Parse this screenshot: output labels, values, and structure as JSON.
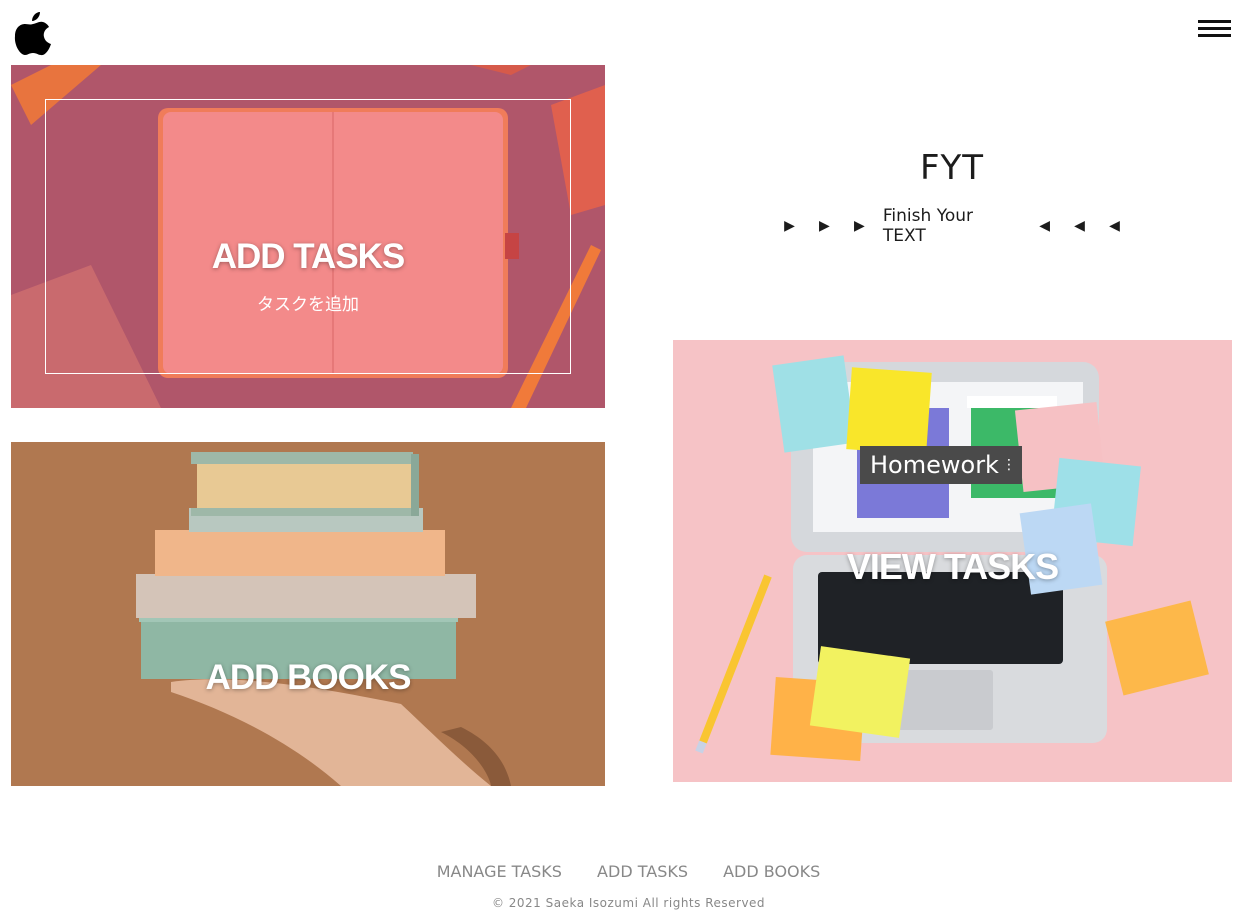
{
  "header": {
    "logo_icon": "apple-logo-icon",
    "menu_icon": "hamburger-menu-icon"
  },
  "hero": {
    "title": "FYT",
    "tagline": "Finish Your TEXT",
    "arrow_right": "▶",
    "arrow_left": "◀"
  },
  "cards": {
    "add_tasks": {
      "title": "ADD TASKS",
      "subtitle": "タスクを追加"
    },
    "add_books": {
      "title": "ADD BOOKS"
    },
    "view_tasks": {
      "title": "VIEW TASKS",
      "note_label": "Homework",
      "note_dots": "⋮"
    }
  },
  "footer": {
    "nav": [
      "MANAGE TASKS",
      "ADD TASKS",
      "ADD BOOKS"
    ],
    "copyright": "© 2021 Saeka Isozumi All rights Reserved"
  },
  "colors": {
    "add_tasks_bg": "#b0566a",
    "notebook": "#f38a8a",
    "add_books_bg": "#b07850",
    "view_tasks_bg": "#f6c3c6",
    "footer_text": "#888888"
  }
}
